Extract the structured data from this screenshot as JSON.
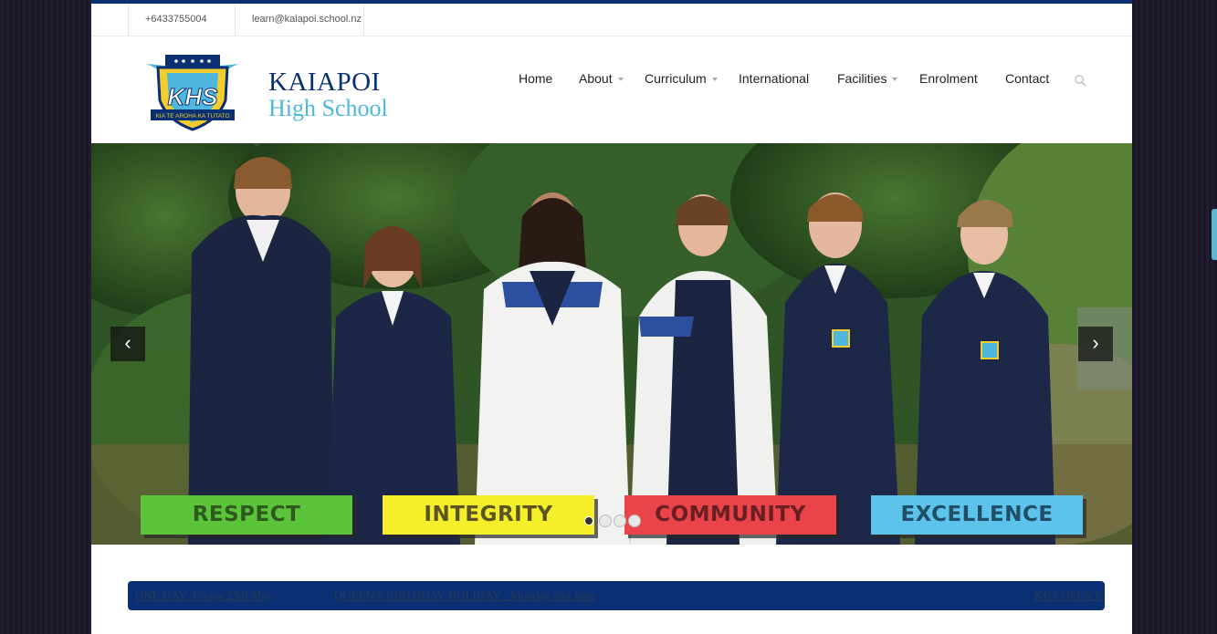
{
  "contact": {
    "phone": "+6433755004",
    "email": "learn@kaiapoi.school.nz"
  },
  "logo": {
    "name": "KAIAPOI",
    "subtitle": "High School",
    "crest_letters": "KHS",
    "crest_motto": "KIA TE AROHA KA TUTATO"
  },
  "nav": {
    "items": [
      {
        "label": "Home",
        "dropdown": false
      },
      {
        "label": "About",
        "dropdown": true
      },
      {
        "label": "Curriculum",
        "dropdown": true
      },
      {
        "label": "International",
        "dropdown": false
      },
      {
        "label": "Facilities",
        "dropdown": true
      },
      {
        "label": "Enrolment",
        "dropdown": false
      },
      {
        "label": "Contact",
        "dropdown": false
      }
    ],
    "search_icon": "search-icon"
  },
  "slider": {
    "prev_icon": "chevron-left-icon",
    "next_icon": "chevron-right-icon",
    "prev_glyph": "‹",
    "next_glyph": "›",
    "values": [
      {
        "label": "RESPECT",
        "color": "#5cc43a",
        "text_color": "#2f5a1e"
      },
      {
        "label": "INTEGRITY",
        "color": "#f4ef2a",
        "text_color": "#5a5520"
      },
      {
        "label": "COMMUNITY",
        "color": "#e8444a",
        "text_color": "#6a1e22"
      },
      {
        "label": "EXCELLENCE",
        "color": "#5ec3ea",
        "text_color": "#1f4f66"
      }
    ],
    "slide_count": 4,
    "active_slide": 1
  },
  "ticker": {
    "items": [
      "ONE DAY: Friday 23rd May",
      "QUEEN'S BIRTHDAY HOLIDAY - Monday 2nd June",
      "KHS OPEN E"
    ]
  },
  "colors": {
    "brand_navy": "#0b2f73",
    "brand_light_blue": "#4fb7dd"
  }
}
